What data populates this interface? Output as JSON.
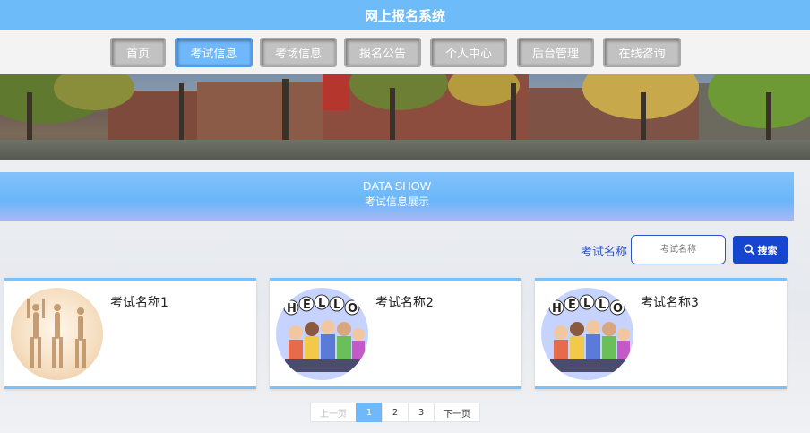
{
  "header": {
    "title": "网上报名系统"
  },
  "nav": {
    "items": [
      {
        "label": "首页",
        "active": false
      },
      {
        "label": "考试信息",
        "active": true
      },
      {
        "label": "考场信息",
        "active": false
      },
      {
        "label": "报名公告",
        "active": false
      },
      {
        "label": "个人中心",
        "active": false
      },
      {
        "label": "后台管理",
        "active": false
      },
      {
        "label": "在线咨询",
        "active": false
      }
    ]
  },
  "section": {
    "title_en": "DATA SHOW",
    "title_cn": "考试信息展示"
  },
  "search": {
    "label": "考试名称",
    "placeholder": "考试名称",
    "button_label": "搜索",
    "icon": "search-icon"
  },
  "cards": [
    {
      "name": "考试名称1",
      "image": "yoga-image"
    },
    {
      "name": "考试名称2",
      "image": "hello-kids-image"
    },
    {
      "name": "考试名称3",
      "image": "hello-kids-image"
    }
  ],
  "pagination": {
    "prev": "上一页",
    "pages": [
      "1",
      "2",
      "3"
    ],
    "current": "1",
    "next": "下一页"
  },
  "colors": {
    "primary": "#6dbcf9",
    "search_button": "#1646cf",
    "accent_text": "#2c54c8"
  }
}
